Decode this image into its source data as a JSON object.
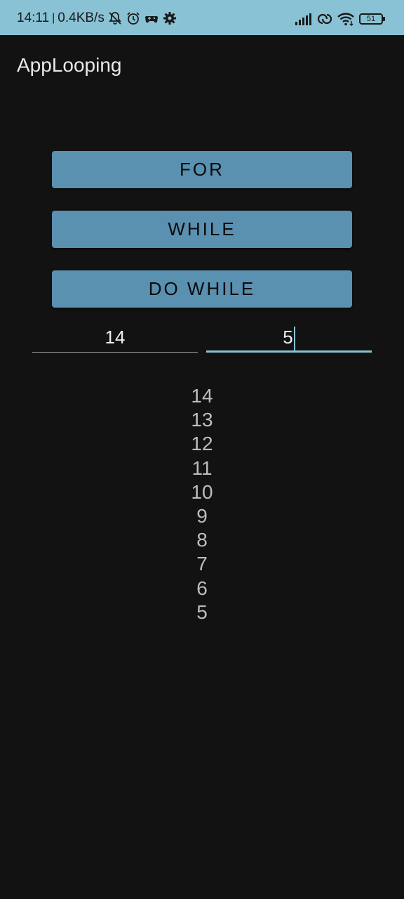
{
  "status_bar": {
    "time": "14:11",
    "separator": "|",
    "network_speed": "0.4KB/s",
    "battery_level": "51",
    "left_icons": [
      "bell-off-icon",
      "alarm-icon",
      "game-controller-icon",
      "gear-icon"
    ],
    "right_icons": [
      "signal-bars-icon",
      "hotspot-link-icon",
      "wifi-icon",
      "battery-icon"
    ],
    "background_color": "#89c2d5"
  },
  "app": {
    "title": "AppLooping"
  },
  "buttons": {
    "for_label": "FOR",
    "while_label": "WHILE",
    "do_while_label": "DO WHILE",
    "color": "#5a90b0"
  },
  "inputs": {
    "start_value": "14",
    "end_value": "5",
    "focused": "end",
    "accent_color": "#89c2d5"
  },
  "output": {
    "lines": [
      "14",
      "13",
      "12",
      "11",
      "10",
      "9",
      "8",
      "7",
      "6",
      "5"
    ]
  }
}
